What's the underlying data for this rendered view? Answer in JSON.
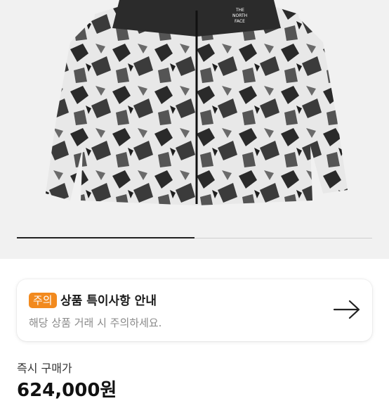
{
  "product": {
    "image_alt": "black and white mountain print puffer jacket",
    "logo_text": "THE NORTH FACE"
  },
  "carousel": {
    "progress": 0.5
  },
  "notice": {
    "badge": "주의",
    "title": "상품 특이사항 안내",
    "description": "해당 상품 거래 시 주의하세요.",
    "icon": "arrow-right-icon"
  },
  "price": {
    "label": "즉시 구매가",
    "value": "624,000원"
  }
}
